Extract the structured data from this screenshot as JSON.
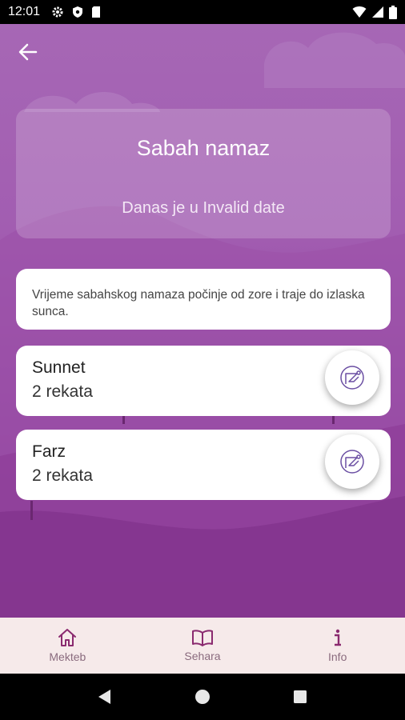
{
  "status_bar": {
    "time": "12:01"
  },
  "header": {
    "title": "Sabah namaz",
    "subtitle": "Danas je u Invalid date"
  },
  "description": "Vrijeme sabahskog namaza počinje od zore i traje do izlaska sunca.",
  "rakats": [
    {
      "name": "Sunnet",
      "count": "2 rekata"
    },
    {
      "name": "Farz",
      "count": "2 rekata"
    }
  ],
  "bottom_nav": [
    {
      "label": "Mekteb",
      "icon": "home-icon"
    },
    {
      "label": "Sehara",
      "icon": "book-icon"
    },
    {
      "label": "Info",
      "icon": "info-icon"
    }
  ],
  "colors": {
    "accent": "#8a2a6f",
    "background_top": "#a667b5",
    "background_bottom": "#7e2f8b",
    "nav_background": "#f6eaea",
    "nav_label": "#8a6b7e"
  }
}
